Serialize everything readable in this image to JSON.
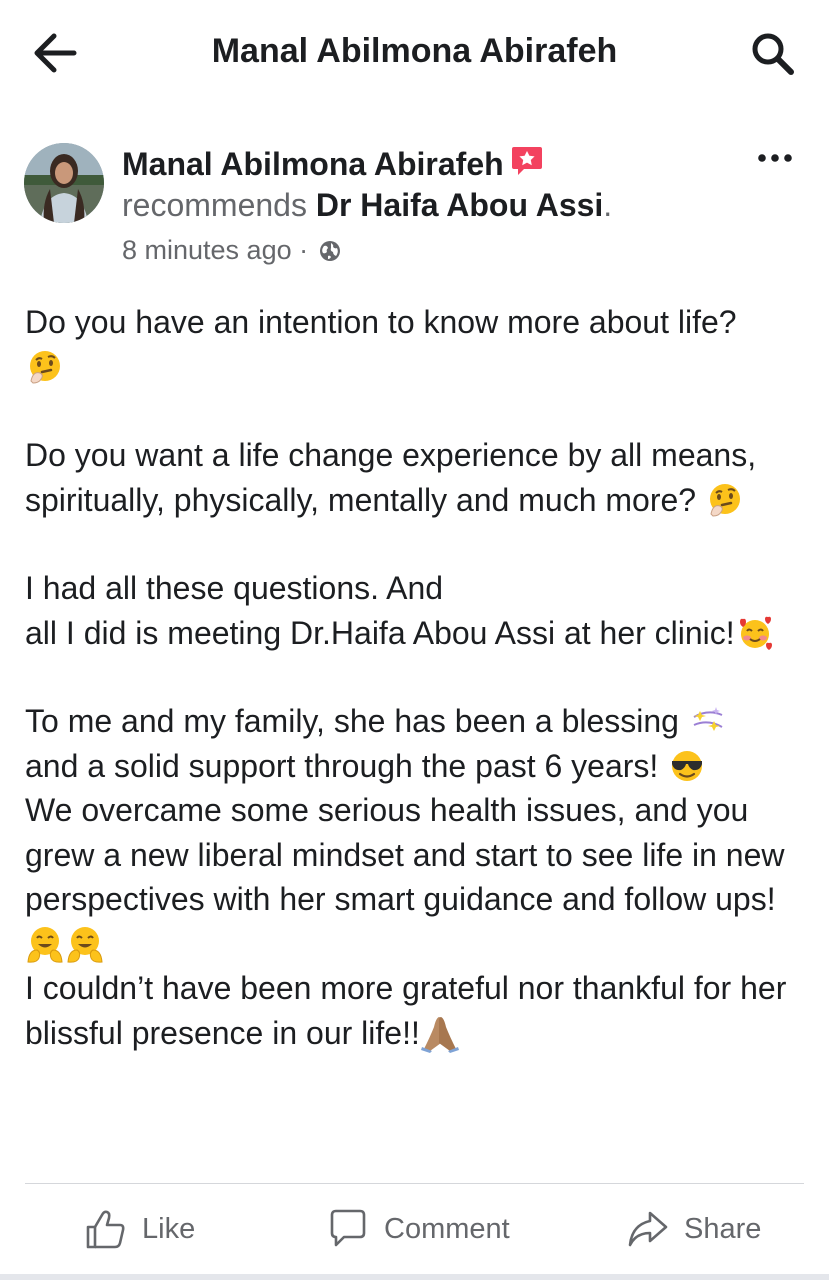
{
  "header": {
    "title": "Manal Abilmona Abirafeh",
    "back_icon": "arrow-left-icon",
    "search_icon": "search-icon"
  },
  "post": {
    "author": "Manal Abilmona Abirafeh",
    "action": "recommends",
    "page": "Dr Haifa Abou Assi",
    "period": ".",
    "time": "8 minutes ago",
    "separator": "·",
    "audience_icon": "globe-icon",
    "paragraphs": {
      "p1": "Do you have an intention to know more about life?",
      "p2": "Do  you want a life change experience by all means, spiritually, physically, mentally and much more?",
      "p3a": "I had  all these questions. And",
      "p3b": "all I did is meeting  Dr.Haifa Abou Assi at her clinic!",
      "p4a": "To me and my family, she has been a blessing",
      "p4b": "and a solid support through the past 6 years!",
      "p4c": "We overcame some serious health issues, and you grew a new liberal mindset and start to see life in new perspectives  with her smart guidance and follow ups!",
      "p4d": "I couldn’t have been more grateful nor thankful for her blissful presence in our life!!"
    }
  },
  "actions": {
    "like": "Like",
    "comment": "Comment",
    "share": "Share"
  },
  "colors": {
    "text": "#1c1e21",
    "secondary": "#65676b",
    "badge": "#f3425f",
    "divider": "#d5d7db"
  }
}
